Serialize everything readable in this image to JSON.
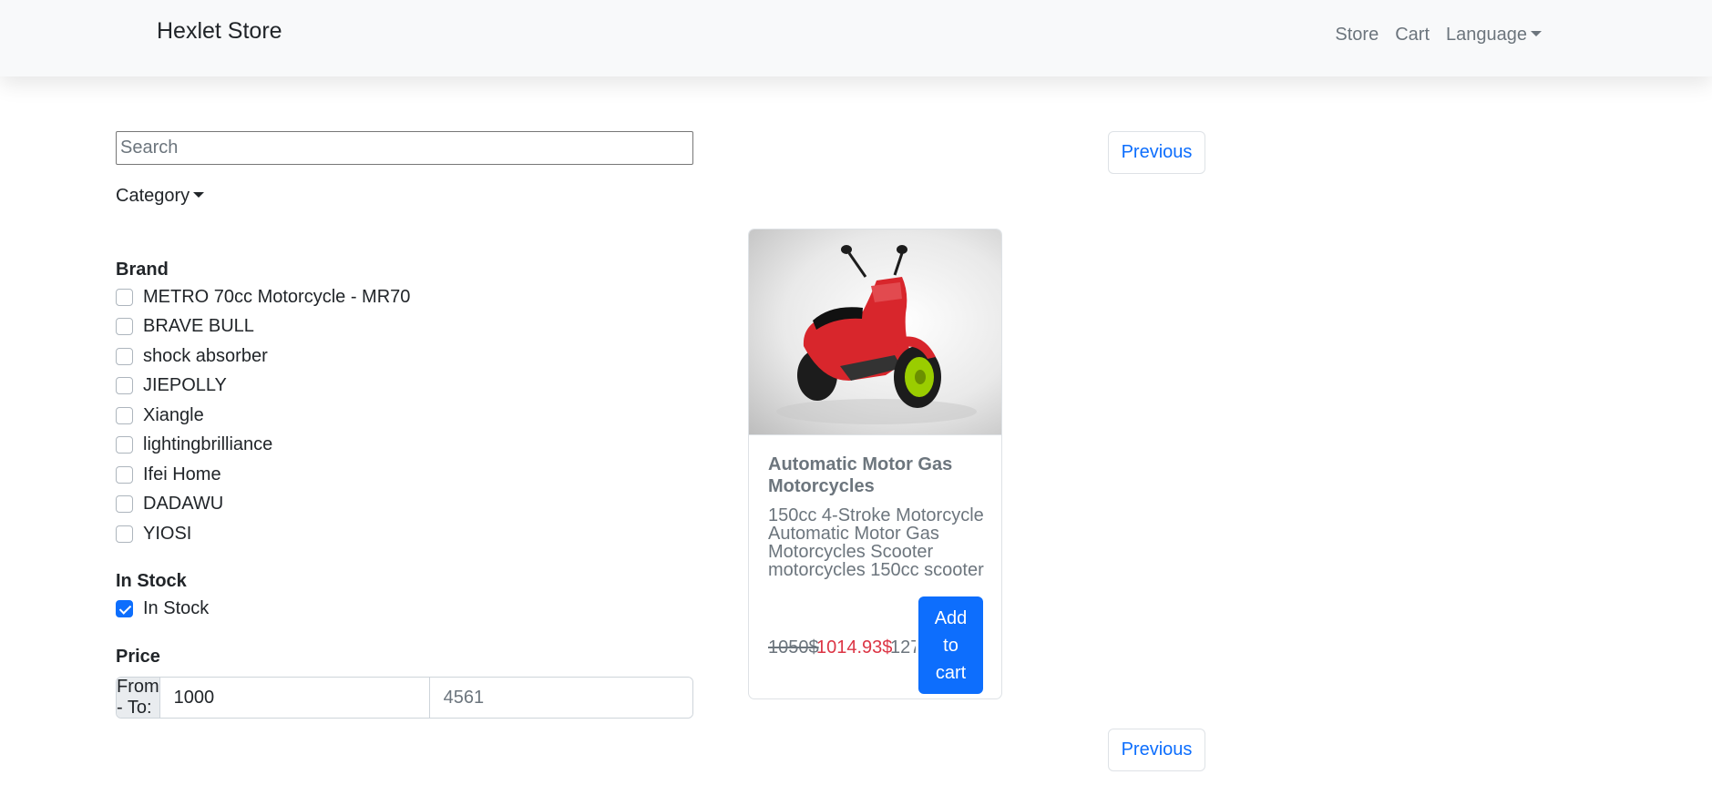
{
  "navbar": {
    "brand": "Hexlet Store",
    "links": {
      "store": "Store",
      "cart": "Cart",
      "language": "Language"
    }
  },
  "filters": {
    "search_placeholder": "Search",
    "category_label": "Category",
    "brand_heading": "Brand",
    "brands": [
      "METRO 70cc Motorcycle - MR70",
      "BRAVE BULL",
      "shock absorber",
      "JIEPOLLY",
      "Xiangle",
      "lightingbrilliance",
      "Ifei Home",
      "DADAWU",
      "YIOSI"
    ],
    "stock_heading": "In Stock",
    "stock_label": "In Stock",
    "stock_checked": true,
    "price_heading": "Price",
    "price_prefix": "From - To:",
    "price_from": "1000",
    "price_to_placeholder": "4561"
  },
  "pagination": {
    "previous_label": "Previous"
  },
  "product": {
    "title": "Automatic Motor Gas Motorcycles",
    "description": "150cc 4-Stroke Motorcycle Automatic Motor Gas Motorcycles Scooter motorcycles 150cc scooter",
    "old_price": "1050$",
    "new_price": "1014.93$",
    "extra": "127",
    "add_to_cart": "Add to cart"
  },
  "colors": {
    "primary": "#0d6efd",
    "sale": "#dc3545",
    "scooter_body": "#d8262c",
    "wheel_accent": "#9acd00"
  }
}
